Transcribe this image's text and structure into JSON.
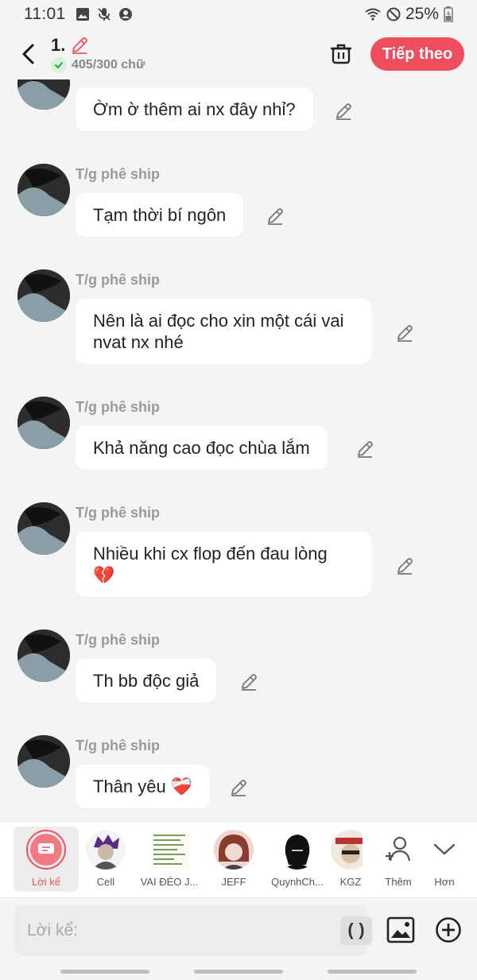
{
  "status_bar": {
    "time": "11:01",
    "battery": "25%",
    "left_icons": [
      "image-icon",
      "mic-off-icon",
      "account-icon"
    ],
    "right_icons": [
      "wifi-icon",
      "do-not-disturb-icon",
      "battery-icon"
    ]
  },
  "header": {
    "chapter_title": "1.",
    "word_count": "405/300 chữ",
    "next_label": "Tiếp theo",
    "accent_color": "#f04e5f"
  },
  "messages": [
    {
      "sender": "",
      "text": "Ờm ờ thêm ai nx đây nhỉ?",
      "partial": true
    },
    {
      "sender": "T/g phê ship",
      "text": "Tạm thời bí ngôn"
    },
    {
      "sender": "T/g phê ship",
      "text": "Nên là ai đọc cho xin một cái vai nvat nx nhé"
    },
    {
      "sender": "T/g phê ship",
      "text": "Khả năng cao đọc chùa lắm"
    },
    {
      "sender": "T/g phê ship",
      "text": "Nhiều khi cx flop đến đau lòng 💔"
    },
    {
      "sender": "T/g phê ship",
      "text": "Th bb độc giả"
    },
    {
      "sender": "T/g phê ship",
      "text": "Thân yêu ❤️‍🩹"
    }
  ],
  "characters": [
    {
      "label": "Lời kể",
      "selected": true
    },
    {
      "label": "Cell"
    },
    {
      "label": "VAI ĐÉO J..."
    },
    {
      "label": "JEFF"
    },
    {
      "label": "QuynhCh..."
    },
    {
      "label": "KGZ"
    },
    {
      "label": "Thêm"
    },
    {
      "label": "Hơn"
    }
  ],
  "input": {
    "placeholder": "Lời kể:",
    "paren_label": "()"
  }
}
